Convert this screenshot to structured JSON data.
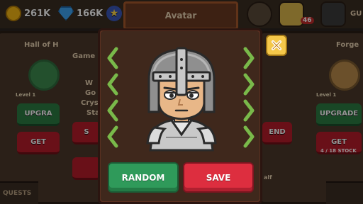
{
  "currencies": {
    "coins": "261K",
    "gems": "166K"
  },
  "header": {
    "tab_title": "Avatar",
    "notification_count": "46"
  },
  "left_panel": {
    "title": "Hall of H",
    "level": "Level 1",
    "upgrade_label": "UPGRA",
    "get_label": "GET",
    "game_label": "Game I",
    "line1": "W",
    "line2": "Go",
    "line3": "Crys",
    "line4": "Sta",
    "s_label": "S"
  },
  "right_panel": {
    "title": "Forge",
    "level": "Level 1",
    "upgrade_label": "UPGRADE",
    "get_label": "GET",
    "progress": "4 / 18 STOCK",
    "end_label": "END",
    "gu_label": "GU",
    "lf_label": "alf"
  },
  "bottom_nav": {
    "quests": "QUESTS"
  },
  "modal": {
    "random_label": "RANDOM",
    "save_label": "SAVE"
  },
  "colors": {
    "accent_green": "#2f9a5a",
    "accent_red": "#dd2e3f",
    "arrow_green": "#79b94a",
    "close_yellow": "#f5c84a"
  }
}
